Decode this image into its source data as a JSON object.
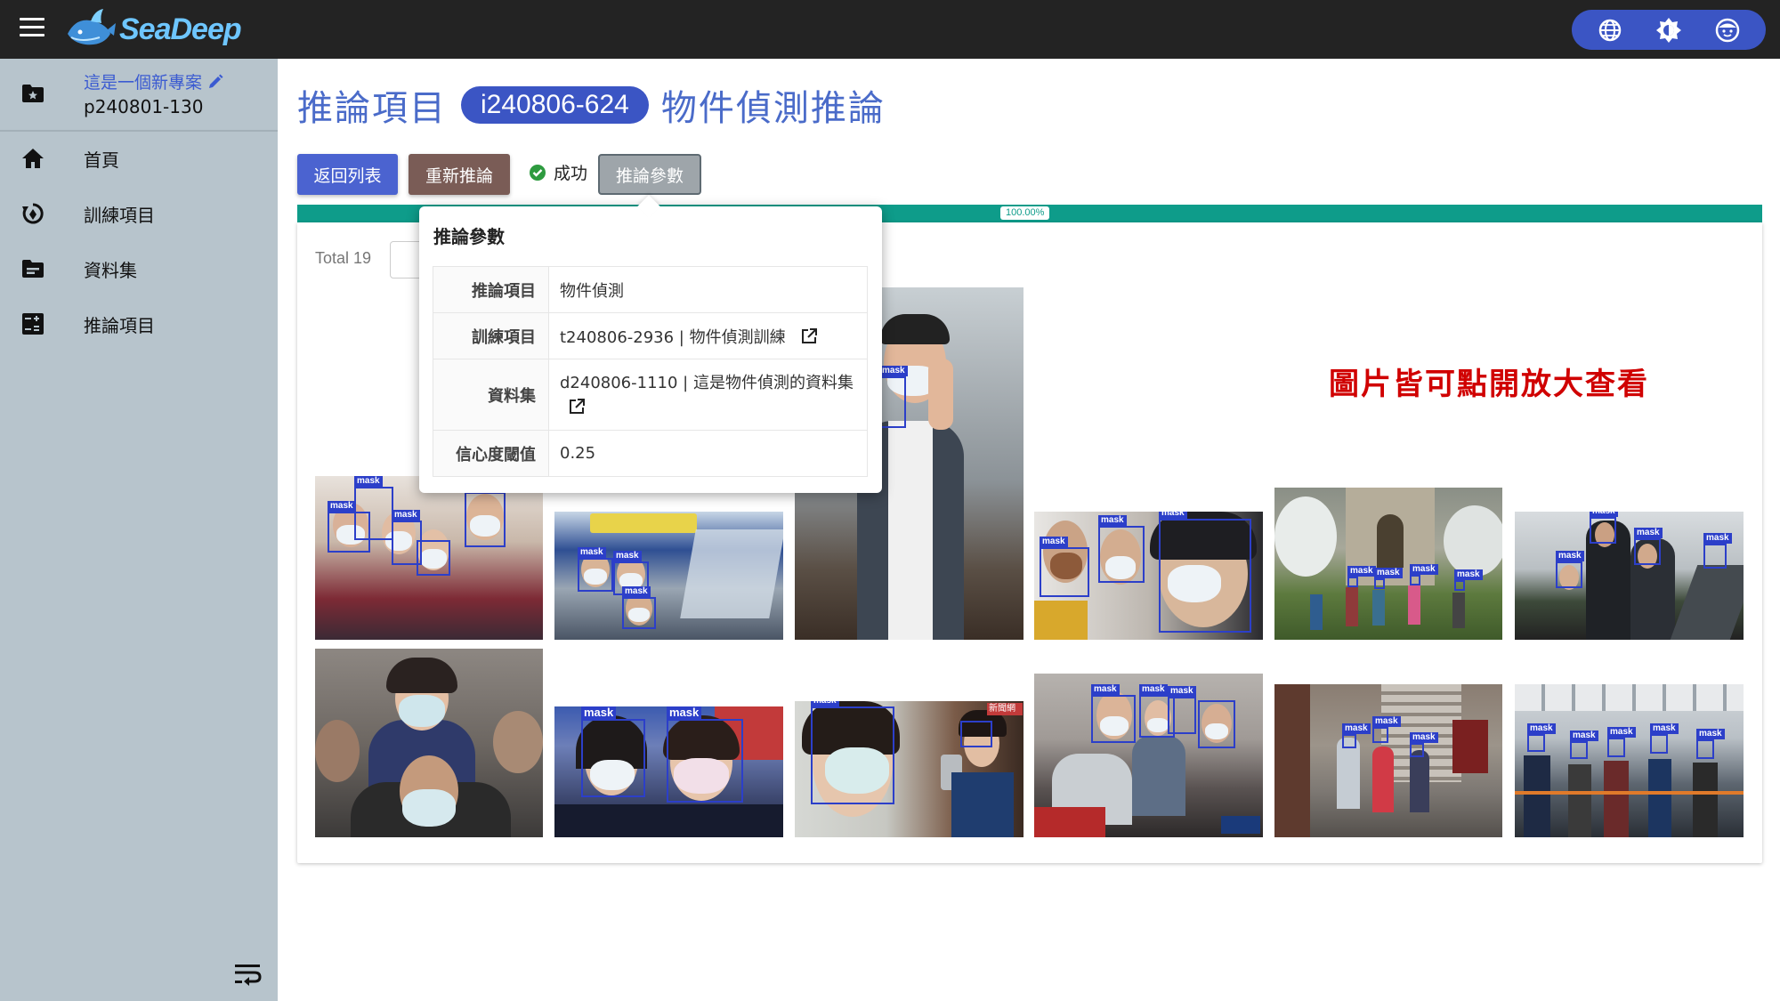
{
  "app": {
    "logo_text": "SeaDeep"
  },
  "sidebar": {
    "project_name": "這是一個新專案",
    "project_id": "p240801-130",
    "items": [
      {
        "label": "首頁",
        "icon": "home-icon"
      },
      {
        "label": "訓練項目",
        "icon": "training-icon"
      },
      {
        "label": "資料集",
        "icon": "folder-icon"
      },
      {
        "label": "推論項目",
        "icon": "calculator-icon"
      }
    ]
  },
  "header": {
    "title_prefix": "推論項目",
    "inference_id": "i240806-624",
    "title_suffix": "物件偵測推論"
  },
  "toolbar": {
    "back_label": "返回列表",
    "rerun_label": "重新推論",
    "status_text": "成功",
    "params_label": "推論參數"
  },
  "progress": {
    "label": "100.00%",
    "value": 1.0
  },
  "gallery": {
    "total_label": "Total 19",
    "bbox_label": "mask",
    "annotation": "圖片皆可點開放大查看",
    "watermark_1": "新聞網"
  },
  "popover": {
    "title": "推論參數",
    "rows": [
      {
        "key": "推論項目",
        "value": "物件偵測"
      },
      {
        "key": "訓練項目",
        "value": "t240806-2936 | 物件偵測訓練"
      },
      {
        "key": "資料集",
        "value": "d240806-1110 | 這是物件偵測的資料集"
      },
      {
        "key": "信心度閾值",
        "value": "0.25"
      }
    ]
  },
  "colors": {
    "topbar": "#232323",
    "sidebar": "#b7c4cc",
    "accent": "#3b55c4",
    "progress": "#0e9c8a",
    "annotation": "#d00000",
    "success": "#2e9b3f"
  }
}
